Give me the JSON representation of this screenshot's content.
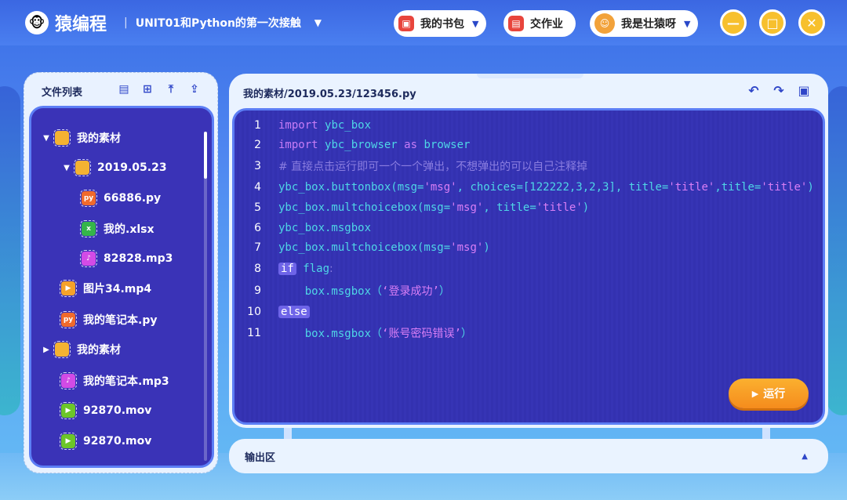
{
  "app": {
    "logo_glyph": "🐵",
    "brand": "猿编程",
    "separator": "|",
    "unit_title": "UNIT01和Python的第一次接触"
  },
  "topbar": {
    "bag_label": "我的书包",
    "homework_label": "交作业",
    "user_label": "我是壮猿呀",
    "caret": "▼"
  },
  "window_controls": {
    "minimize": "—",
    "maximize": "□",
    "close": "✕"
  },
  "file_panel": {
    "title": "文件列表",
    "items": [
      {
        "label": "我的素材",
        "expanded": "▼",
        "icon": "folder"
      },
      {
        "label": "2019.05.23",
        "expanded": "▼",
        "icon": "folder"
      },
      {
        "label": "66886.py",
        "icon": "py-file"
      },
      {
        "label": "我的.xlsx",
        "icon": "xlsx-file"
      },
      {
        "label": "82828.mp3",
        "icon": "mp3-file"
      },
      {
        "label": "图片34.mp4",
        "icon": "mp4-file"
      },
      {
        "label": "我的笔记本.py",
        "icon": "py-file"
      },
      {
        "label": "我的素材",
        "expanded": "▶",
        "icon": "folder"
      },
      {
        "label": "我的笔记本.mp3",
        "icon": "mp3-file"
      },
      {
        "label": "92870.mov",
        "icon": "mov-file"
      },
      {
        "label": "92870.mov",
        "icon": "mov-file"
      }
    ]
  },
  "editor": {
    "path": "我的素材/2019.05.23/123456.py",
    "lines": [
      {
        "n": "1"
      },
      {
        "n": "2"
      },
      {
        "n": "3",
        "comment": "# 直接点击运行即可一个一个弹出，不想弹出的可以自己注释掉"
      },
      {
        "n": "4"
      },
      {
        "n": "5"
      },
      {
        "n": "6"
      },
      {
        "n": "7"
      },
      {
        "n": "8"
      },
      {
        "n": "9"
      },
      {
        "n": "10"
      },
      {
        "n": "11"
      }
    ],
    "run_label": "运行"
  },
  "output": {
    "label": "输出区",
    "toggle": "▲"
  },
  "colors": {
    "accent": "#3a33b7",
    "run_button": "#f59e22",
    "keyword": "#c77cf6",
    "identifier": "#4fd6e6"
  }
}
